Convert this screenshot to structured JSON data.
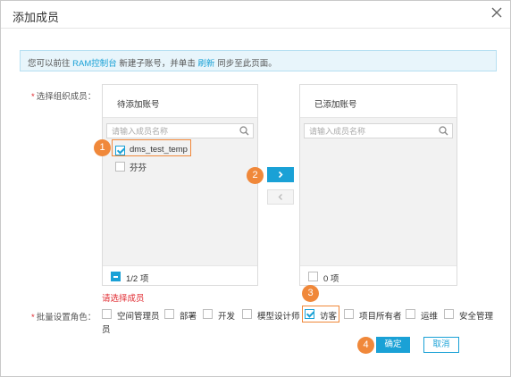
{
  "dialog": {
    "title": "添加成员",
    "close_icon": "close-icon"
  },
  "notice": {
    "prefix": "您可以前往 ",
    "link1": "RAM控制台",
    "middle": " 新建子账号，并单击 ",
    "link2": "刷新",
    "suffix": " 同步至此页面。"
  },
  "members": {
    "label": "选择组织成员：",
    "pending": {
      "title": "待添加账号",
      "search_placeholder": "请输入成员名称",
      "items": [
        {
          "label": "dms_test_temp",
          "checked": true
        },
        {
          "label": "芬芬",
          "checked": false
        }
      ],
      "count": "1/2 项"
    },
    "added": {
      "title": "已添加账号",
      "search_placeholder": "请输入成员名称",
      "count": "0 项"
    },
    "error": "请选择成员"
  },
  "roles": {
    "label": "批量设置角色：",
    "items": [
      {
        "label": "空间管理员",
        "checked": false
      },
      {
        "label": "部署",
        "checked": false
      },
      {
        "label": "开发",
        "checked": false
      },
      {
        "label": "模型设计师",
        "checked": false
      },
      {
        "label": "访客",
        "checked": true
      },
      {
        "label": "项目所有者",
        "checked": false
      },
      {
        "label": "运维",
        "checked": false
      },
      {
        "label": "安全管理",
        "checked": false
      }
    ],
    "wrap_text": "员"
  },
  "buttons": {
    "ok": "确定",
    "cancel": "取消"
  },
  "steps": [
    "1",
    "2",
    "3",
    "4"
  ],
  "colors": {
    "accent": "#1aa1d6",
    "step": "#f0883a",
    "error": "#e0282e"
  }
}
